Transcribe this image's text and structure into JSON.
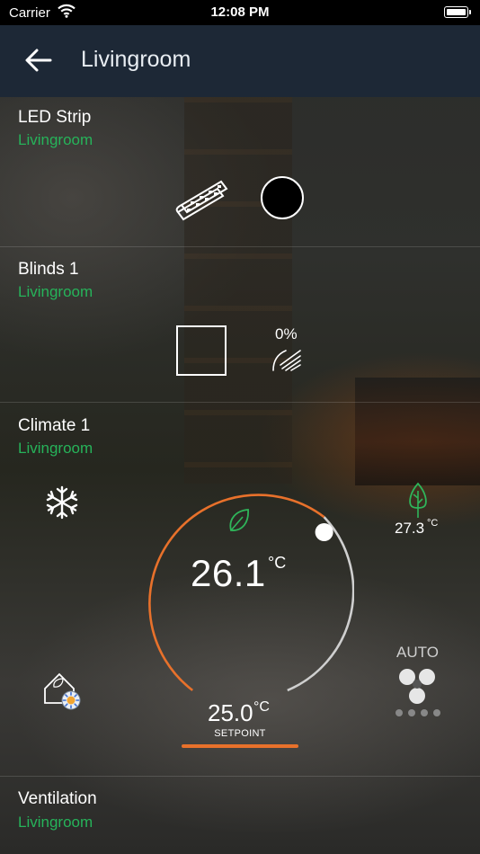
{
  "status_bar": {
    "carrier": "Carrier",
    "time": "12:08 PM"
  },
  "nav": {
    "title": "Livingroom",
    "back_icon": "arrow-left-icon"
  },
  "devices": [
    {
      "name": "LED Strip",
      "room": "Livingroom"
    },
    {
      "name": "Blinds 1",
      "room": "Livingroom",
      "position": "0%"
    },
    {
      "name": "Climate 1",
      "room": "Livingroom",
      "current_temp": "26.1",
      "current_unit": "°C",
      "setpoint": "25.0",
      "setpoint_unit": "°C",
      "setpoint_label": "SETPOINT",
      "outdoor_temp": "27.3",
      "outdoor_unit": "°C",
      "fan_mode": "AUTO",
      "mode_icon": "snowflake-icon"
    },
    {
      "name": "Ventilation",
      "room": "Livingroom"
    }
  ],
  "colors": {
    "accent_orange": "#e8712b",
    "room_green": "#26b35a",
    "navbar": "#1d2836",
    "leaf_green": "#2fb55a"
  }
}
